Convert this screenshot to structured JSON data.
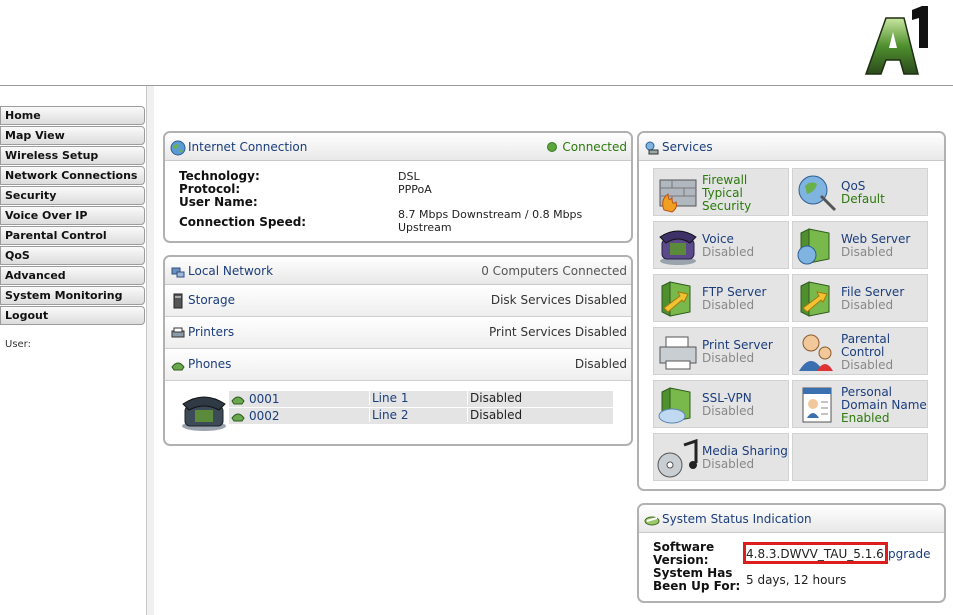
{
  "header": {
    "logo_text": "A1"
  },
  "sidebar": {
    "items": [
      {
        "label": "Home"
      },
      {
        "label": "Map View"
      },
      {
        "label": "Wireless Setup"
      },
      {
        "label": "Network Connections"
      },
      {
        "label": "Security"
      },
      {
        "label": "Voice Over IP"
      },
      {
        "label": "Parental Control"
      },
      {
        "label": "QoS"
      },
      {
        "label": "Advanced"
      },
      {
        "label": "System Monitoring"
      },
      {
        "label": "Logout"
      }
    ],
    "user_label": "User:"
  },
  "internet": {
    "title": "Internet Connection",
    "status": "Connected",
    "status_color": "#5aa63c",
    "fields": [
      {
        "key": "Technology:",
        "value": "DSL"
      },
      {
        "key": "Protocol:",
        "value": "PPPoA"
      },
      {
        "key": "User Name:",
        "value": ""
      },
      {
        "key": "Connection Speed:",
        "value": "8.7 Mbps Downstream / 0.8 Mbps Upstream"
      }
    ]
  },
  "local": {
    "title": "Local Network",
    "computers": "0 Computers Connected",
    "storage": {
      "label": "Storage",
      "status": "Disk Services Disabled"
    },
    "printers": {
      "label": "Printers",
      "status": "Print Services Disabled"
    },
    "phones": {
      "label": "Phones",
      "status": "Disabled"
    },
    "phone_lines": [
      {
        "number": "0001",
        "line": "Line 1",
        "status": "Disabled"
      },
      {
        "number": "0002",
        "line": "Line 2",
        "status": "Disabled"
      }
    ]
  },
  "services": {
    "title": "Services",
    "items": [
      {
        "name": "Firewall",
        "status_lines": [
          "Typical",
          "Security"
        ],
        "enabled": true,
        "icon": "firewall-icon"
      },
      {
        "name": "QoS",
        "status_lines": [
          "Default"
        ],
        "enabled": true,
        "icon": "qos-icon"
      },
      {
        "name": "Voice",
        "status_lines": [
          "Disabled"
        ],
        "enabled": false,
        "icon": "voice-icon"
      },
      {
        "name": "Web Server",
        "status_lines": [
          "Disabled"
        ],
        "enabled": false,
        "icon": "web-server-icon"
      },
      {
        "name": "FTP Server",
        "status_lines": [
          "Disabled"
        ],
        "enabled": false,
        "icon": "ftp-server-icon"
      },
      {
        "name": "File Server",
        "status_lines": [
          "Disabled"
        ],
        "enabled": false,
        "icon": "file-server-icon"
      },
      {
        "name": "Print Server",
        "status_lines": [
          "Disabled"
        ],
        "enabled": false,
        "icon": "print-server-icon"
      },
      {
        "name": "Parental Control",
        "name_lines": [
          "Parental",
          "Control"
        ],
        "status_lines": [
          "Disabled"
        ],
        "enabled": false,
        "icon": "parental-control-icon"
      },
      {
        "name": "SSL-VPN",
        "status_lines": [
          "Disabled"
        ],
        "enabled": false,
        "icon": "ssl-vpn-icon"
      },
      {
        "name": "Personal Domain Name",
        "name_lines": [
          "Personal",
          "Domain Name"
        ],
        "status_lines": [
          "Enabled"
        ],
        "enabled": true,
        "icon": "personal-domain-icon"
      },
      {
        "name": "Media Sharing",
        "status_lines": [
          "Disabled"
        ],
        "enabled": false,
        "icon": "media-sharing-icon"
      }
    ]
  },
  "system_status": {
    "title": "System Status Indication",
    "software_version_label_1": "Software",
    "software_version_label_2": "Version:",
    "software_version": "4.8.3.DWVV_TAU_5.1.6",
    "upgrade_suffix": "pgrade",
    "uptime_label_1": "System Has",
    "uptime_label_2": "Been Up For:",
    "uptime": "5 days, 12 hours",
    "highlight_color": "#dd1c1c"
  },
  "colors": {
    "link_blue": "#1b3d7c",
    "enabled_green": "#2b7a0b",
    "disabled_gray": "#888888"
  }
}
